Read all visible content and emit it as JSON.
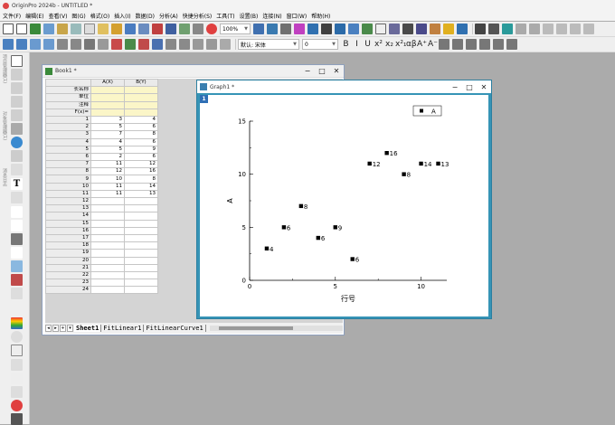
{
  "app": {
    "title": "OriginPro 2024b - UNTITLED *"
  },
  "menu": [
    "文件(F)",
    "编辑(E)",
    "查看(V)",
    "图(G)",
    "格式(O)",
    "插入(I)",
    "数据(D)",
    "分析(A)",
    "快捷分析(S)",
    "工具(T)",
    "设置(B)",
    "连接(N)",
    "窗口(W)",
    "帮助(H)"
  ],
  "toolbar": {
    "zoom": "100%",
    "font_name": "默认: 宋体",
    "font_size": "0"
  },
  "format_buttons": [
    "B",
    "I",
    "U",
    "x²",
    "x₂",
    "x²₁",
    "αβ",
    "A⁺",
    "A⁻"
  ],
  "left_labels": [
    "项目管理器(1)",
    "对象管理器(1)",
    "消息日志"
  ],
  "book": {
    "title": "Book1 *",
    "col_a": "A(X)",
    "col_b": "B(Y)",
    "meta_rows": [
      "长名称",
      "单位",
      "注释",
      "F(x)="
    ],
    "rows": [
      {
        "n": "1",
        "a": "3",
        "b": "4"
      },
      {
        "n": "2",
        "a": "5",
        "b": "6"
      },
      {
        "n": "3",
        "a": "7",
        "b": "8"
      },
      {
        "n": "4",
        "a": "4",
        "b": "6"
      },
      {
        "n": "5",
        "a": "5",
        "b": "9"
      },
      {
        "n": "6",
        "a": "2",
        "b": "6"
      },
      {
        "n": "7",
        "a": "11",
        "b": "12"
      },
      {
        "n": "8",
        "a": "12",
        "b": "16"
      },
      {
        "n": "9",
        "a": "10",
        "b": "8"
      },
      {
        "n": "10",
        "a": "11",
        "b": "14"
      },
      {
        "n": "11",
        "a": "11",
        "b": "13"
      },
      {
        "n": "12",
        "a": "",
        "b": ""
      },
      {
        "n": "13",
        "a": "",
        "b": ""
      },
      {
        "n": "14",
        "a": "",
        "b": ""
      },
      {
        "n": "15",
        "a": "",
        "b": ""
      },
      {
        "n": "16",
        "a": "",
        "b": ""
      },
      {
        "n": "17",
        "a": "",
        "b": ""
      },
      {
        "n": "18",
        "a": "",
        "b": ""
      },
      {
        "n": "19",
        "a": "",
        "b": ""
      },
      {
        "n": "20",
        "a": "",
        "b": ""
      },
      {
        "n": "21",
        "a": "",
        "b": ""
      },
      {
        "n": "22",
        "a": "",
        "b": ""
      },
      {
        "n": "23",
        "a": "",
        "b": ""
      },
      {
        "n": "24",
        "a": "",
        "b": ""
      }
    ],
    "sheets": [
      "Sheet1",
      "FitLinear1",
      "FitLinearCurve1"
    ]
  },
  "graph": {
    "title": "Graph1 *",
    "layer": "1",
    "legend": "A",
    "chart_data": {
      "type": "scatter",
      "xlabel": "行号",
      "ylabel": "A",
      "xlim": [
        0,
        11.5
      ],
      "ylim": [
        0,
        15
      ],
      "xticks": [
        "0",
        "5",
        "10"
      ],
      "yticks": [
        "0",
        "5",
        "10",
        "15"
      ],
      "points": [
        {
          "x": 1,
          "y": 3,
          "label": "4"
        },
        {
          "x": 2,
          "y": 5,
          "label": "6"
        },
        {
          "x": 3,
          "y": 7,
          "label": "8"
        },
        {
          "x": 4,
          "y": 4,
          "label": "6"
        },
        {
          "x": 5,
          "y": 5,
          "label": "9"
        },
        {
          "x": 6,
          "y": 2,
          "label": "6"
        },
        {
          "x": 7,
          "y": 11,
          "label": "12"
        },
        {
          "x": 8,
          "y": 12,
          "label": "16"
        },
        {
          "x": 9,
          "y": 10,
          "label": "8"
        },
        {
          "x": 10,
          "y": 11,
          "label": "14"
        },
        {
          "x": 11,
          "y": 11,
          "label": "13"
        }
      ]
    }
  },
  "window_buttons": {
    "min": "−",
    "max": "□",
    "close": "✕"
  }
}
